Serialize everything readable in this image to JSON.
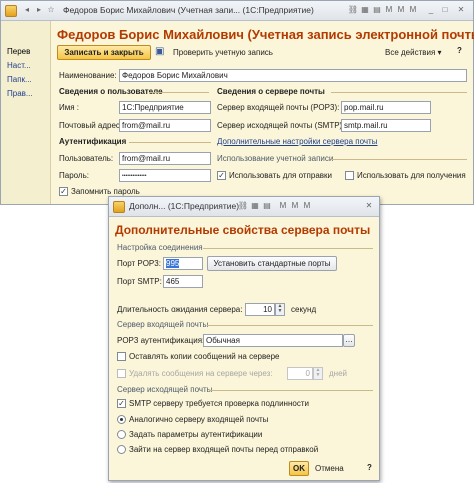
{
  "main_window": {
    "title": "Федоров Борис Михайлович (Учетная запи... (1С:Предприятие)",
    "nav": [
      "Перев",
      "Наст...",
      "Папк...",
      "Прав..."
    ],
    "heading": "Федоров Борис Михайлович (Учетная запись электронной почты)",
    "toolbar": {
      "save_close": "Записать и закрыть",
      "check": "Проверить учетную запись",
      "all_actions": "Все действия ▾",
      "help": "?"
    },
    "name_label": "Наименование:",
    "name_value": "Федоров Борис Михайлович",
    "user_section": "Сведения о пользователе",
    "server_section": "Сведения о сервере почты",
    "fields": {
      "name_label": "Имя :",
      "name_value": "1С:Предприятие",
      "email_label": "Почтовый адрес:",
      "email_value": "from@mail.ru",
      "pop3_label": "Сервер входящей почты (POP3):",
      "pop3_value": "pop.mail.ru",
      "smtp_label": "Сервер исходящей почты (SMTP):",
      "smtp_value": "smtp.mail.ru"
    },
    "advanced_link": "Дополнительные настройки сервера почты",
    "auth_section": "Аутентификация",
    "usage_section": "Использование учетной записи",
    "user_label": "Пользователь:",
    "user_value": "from@mail.ru",
    "password_label": "Пароль:",
    "password_value": "••••••••••••••",
    "use_send": "Использовать для отправки",
    "use_receive": "Использовать для получения",
    "remember": "Запомнить пароль"
  },
  "dialog": {
    "title": "Дополн... (1С:Предприятие)",
    "heading": "Дополнительные свойства сервера почты",
    "conn_section": "Настройка соединения",
    "pop3_port_label": "Порт POP3:",
    "pop3_port_value": "995",
    "smtp_port_label": "Порт SMTP:",
    "smtp_port_value": "465",
    "std_ports_btn": "Установить стандартные порты",
    "timeout_label": "Длительность ожидания сервера:",
    "timeout_value": "10",
    "timeout_unit": "секунд",
    "incoming_section": "Сервер входящей почты",
    "pop3_auth_label": "POP3 аутентификация:",
    "pop3_auth_value": "Обычная",
    "leave_copies": "Оставлять копии сообщений на сервере",
    "delete_after": "Удалять сообщения на сервере через:",
    "delete_days": "0",
    "days": "дней",
    "outgoing_section": "Сервер исходящей почты",
    "smtp_auth": "SMTP серверу требуется проверка подлинности",
    "opt1": "Аналогично серверу входящей почты",
    "opt2": "Задать параметры аутентификации",
    "opt3": "Зайти на сервер входящей почты перед отправкой",
    "ok": "OK",
    "cancel": "Отмена",
    "help": "?"
  }
}
